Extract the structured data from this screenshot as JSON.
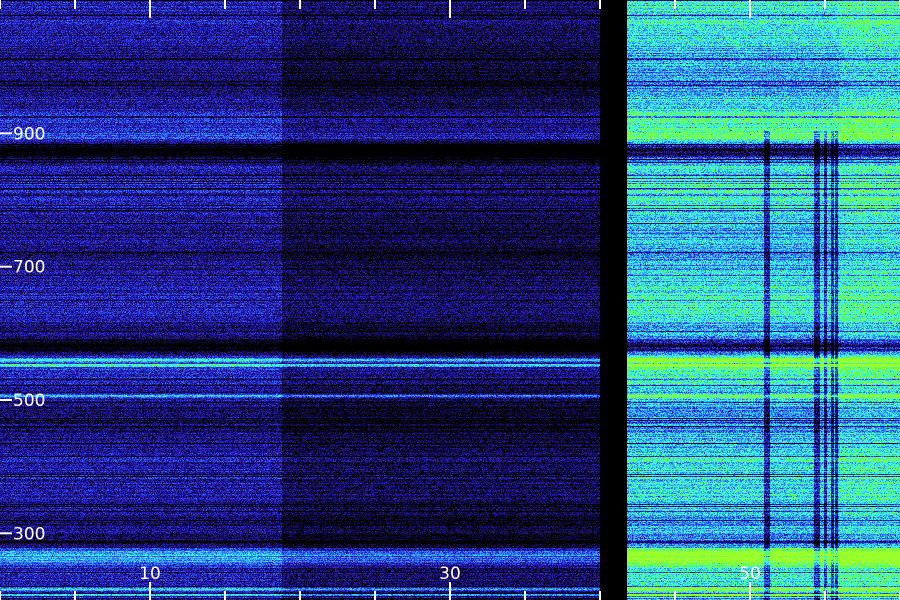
{
  "chart_data": {
    "type": "heatmap",
    "title": "",
    "xlabel": "",
    "ylabel": "",
    "xlim": [
      0,
      60
    ],
    "ylim": [
      200,
      1100
    ],
    "x_ticks_major": [
      10,
      30,
      50
    ],
    "x_tick_labels": [
      "10",
      "30",
      "50"
    ],
    "x_ticks_minor": [
      0,
      5,
      15,
      20,
      25,
      35,
      40,
      45,
      55,
      60
    ],
    "y_ticks_major": [
      300,
      500,
      700,
      900
    ],
    "y_tick_labels": [
      "300",
      "500",
      "700",
      "900"
    ],
    "grid": false,
    "colormap": [
      "#000000",
      "#1a0a6e",
      "#2a2ad6",
      "#2f8cff",
      "#3df2ff",
      "#55ff5a",
      "#9aff2a"
    ],
    "segments": [
      {
        "x_range": [
          0,
          18.8
        ],
        "relative_intensity": "medium"
      },
      {
        "x_range": [
          18.8,
          40
        ],
        "relative_intensity": "low"
      },
      {
        "x_range": [
          40,
          41.8
        ],
        "relative_intensity": "none"
      },
      {
        "x_range": [
          41.8,
          60
        ],
        "relative_intensity": "high"
      }
    ],
    "strong_rows_y": [
      561,
      553,
      507,
      217,
      208
    ]
  }
}
